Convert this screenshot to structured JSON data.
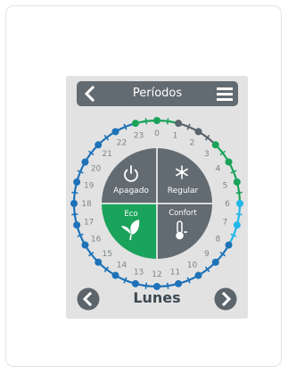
{
  "header": {
    "title": "Períodos",
    "back_icon": "chevron-left-icon",
    "menu_icon": "hamburger-menu-icon"
  },
  "modes": {
    "off": {
      "label": "Apagado",
      "icon": "power-icon"
    },
    "regular": {
      "label": "Regular",
      "icon": "snowflake-icon"
    },
    "eco": {
      "label": "Eco",
      "icon": "leaf-icon"
    },
    "comfort": {
      "label": "Confort",
      "icon": "thermometer-icon"
    }
  },
  "hours": [
    "0",
    "1",
    "2",
    "3",
    "4",
    "5",
    "6",
    "7",
    "8",
    "9",
    "10",
    "11",
    "12",
    "13",
    "14",
    "15",
    "16",
    "17",
    "18",
    "19",
    "20",
    "21",
    "22",
    "23"
  ],
  "hour_slots": [
    "green",
    "dark",
    "dark",
    "green",
    "green",
    "green",
    "cyan",
    "cyan",
    "blue",
    "blue",
    "blue",
    "blue",
    "blue",
    "blue",
    "blue",
    "blue",
    "blue",
    "blue",
    "blue",
    "blue",
    "blue",
    "blue",
    "blue",
    "green"
  ],
  "day": {
    "label": "Lunes",
    "prev_icon": "chevron-left-icon",
    "next_icon": "chevron-right-icon"
  },
  "colors": {
    "header_bg": "#626b71",
    "panel_bg": "#e2e2e2",
    "dial_dark": "#626b71",
    "eco_green": "#1aa35a",
    "slot_green": "#1aa35a",
    "slot_dark": "#59636b",
    "slot_cyan": "#22b7e8",
    "slot_blue": "#1d72b8",
    "number_gray": "#7c8488"
  }
}
